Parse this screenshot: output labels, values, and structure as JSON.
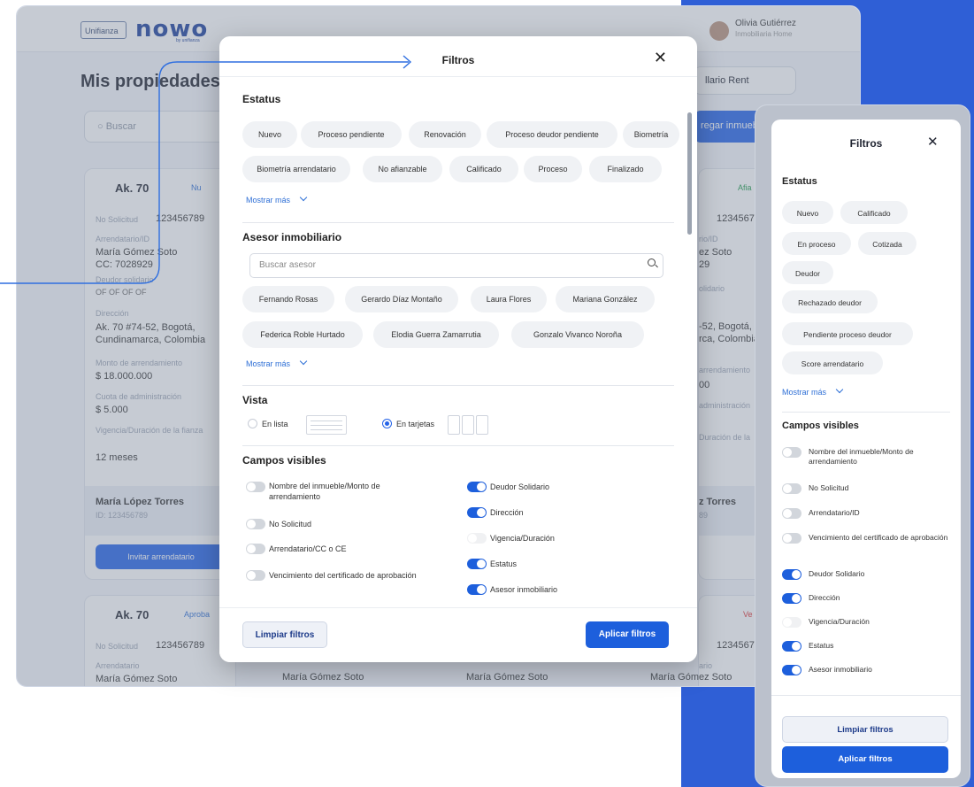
{
  "brand": {
    "logo_left": "Unifianza",
    "logo_right": "nowo",
    "logo_right_sub": "by unifianza"
  },
  "user": {
    "name": "Olivia Gutiérrez",
    "role": "Inmobiliaria Home"
  },
  "page": {
    "title": "Mis propiedades y fi",
    "search_placeholder": "Buscar",
    "select_value": "llario Rent",
    "add_button": "regar inmueble"
  },
  "bg_cards": [
    {
      "title": "Ak. 70",
      "badge": "Nu",
      "no_solicitud_label": "No Solicitud",
      "no_solicitud": "123456789",
      "arrendatario_label": "Arrendatario/ID",
      "arrendatario": "María Gómez Soto",
      "cc": "CC: 7028929",
      "deudor_label": "Deudor solidario",
      "deudor": "OF OF OF OF",
      "direccion_label": "Dirección",
      "direccion": "Ak. 70 #74-52, Bogotá, Cundinamarca, Colombia",
      "monto_label": "Monto de arrendamiento",
      "monto": "$ 18.000.000",
      "cuota_label": "Cuota de administración",
      "cuota": "$ 5.000",
      "vigencia_label": "Vigencia/Duración de la fianza",
      "vigencia": "12 meses",
      "asesor": "María López Torres",
      "asesor_id": "ID: 123456789",
      "button": "Invitar arrendatario"
    },
    {
      "title": "Ak. 70",
      "badge": "Aproba",
      "no_solicitud_label": "No Solicitud",
      "no_solicitud": "123456789",
      "arrendatario_label": "Arrendatario",
      "arrendatario": "María Gómez Soto"
    }
  ],
  "bg_right": {
    "number": "12345678",
    "arr_label": "rio/ID",
    "arr_val": "ez Soto",
    "cc": "29",
    "deudor_label": "olidario",
    "dir": "-52, Bogotá,",
    "dir2": "rca, Colombia",
    "monto_label": "arrendamiento",
    "monto": "00",
    "cuota_label": "administración",
    "vig_label": "Duración de la",
    "torres": "z Torres",
    "torres_id": "89",
    "badge_top": "Afia",
    "badge_low": "Ve",
    "bottom_num": "12345678",
    "bottom_arr": "ario",
    "bottom_label_7": "7"
  },
  "bottom_names": [
    "María Gómez Soto",
    "María Gómez Soto",
    "María Gómez Soto"
  ],
  "modal": {
    "title": "Filtros",
    "close": "✕",
    "estatus_title": "Estatus",
    "estatus_chips_row1": [
      "Nuevo",
      "Proceso pendiente",
      "Renovación",
      "Proceso deudor pendiente",
      "Biometría"
    ],
    "estatus_chips_row2": [
      "Biometría arrendatario",
      "No afianzable",
      "Calificado",
      "Proceso",
      "Finalizado"
    ],
    "show_more": "Mostrar más",
    "asesor_title": "Asesor inmobiliario",
    "asesor_placeholder": "Buscar asesor",
    "asesor_chips_row1": [
      "Fernando Rosas",
      "Gerardo Díaz Montaño",
      "Laura Flores",
      "Mariana González"
    ],
    "asesor_chips_row2": [
      "Federica Roble Hurtado",
      "Elodia Guerra Zamarrutia",
      "Gonzalo Vivanco Noroña"
    ],
    "vista_title": "Vista",
    "vista_list": "En lista",
    "vista_cards": "En tarjetas",
    "campos_title": "Campos visibles",
    "campos_left": [
      {
        "label": "Nombre del inmueble/Monto de arrendamiento",
        "state": "grey"
      },
      {
        "label": "No Solicitud",
        "state": "grey"
      },
      {
        "label": "Arrendatario/CC o CE",
        "state": "grey"
      },
      {
        "label": "Vencimiento del certificado de aprobación",
        "state": "grey"
      }
    ],
    "campos_right": [
      {
        "label": "Deudor Solidario",
        "state": "on"
      },
      {
        "label": "Dirección",
        "state": "on"
      },
      {
        "label": "Vigencia/Duración",
        "state": "dis"
      },
      {
        "label": "Estatus",
        "state": "on"
      },
      {
        "label": "Asesor inmobiliario",
        "state": "on"
      }
    ],
    "clear_button": "Limpiar filtros",
    "apply_button": "Aplicar filtros"
  },
  "phone": {
    "title": "Filtros",
    "close": "✕",
    "estatus_title": "Estatus",
    "chips": [
      "Nuevo",
      "Calificado",
      "En proceso",
      "Cotizada",
      "Deudor",
      "Rechazado deudor",
      "Pendiente proceso deudor",
      "Score arrendatario"
    ],
    "show_more": "Mostrar más",
    "campos_title": "Campos visibles",
    "campos": [
      {
        "label": "Nombre del inmueble/Monto de arrendamiento",
        "state": "off"
      },
      {
        "label": "No Solicitud",
        "state": "off"
      },
      {
        "label": "Arrendatario/ID",
        "state": "off"
      },
      {
        "label": "Vencimiento del certificado de aprobación",
        "state": "off"
      },
      {
        "label": "Deudor Solidario",
        "state": "on"
      },
      {
        "label": "Dirección",
        "state": "on"
      },
      {
        "label": "Vigencia/Duración",
        "state": "dis"
      },
      {
        "label": "Estatus",
        "state": "on"
      },
      {
        "label": "Asesor inmobiliario",
        "state": "on"
      }
    ],
    "clear_button": "Limpiar filtros",
    "apply_button": "Aplicar filtros",
    "bottom_id": "ID: 123456789"
  },
  "colors": {
    "accent": "#1d5fdc",
    "brand_dark": "#1b3f9b",
    "band": "#2f5fd6"
  }
}
